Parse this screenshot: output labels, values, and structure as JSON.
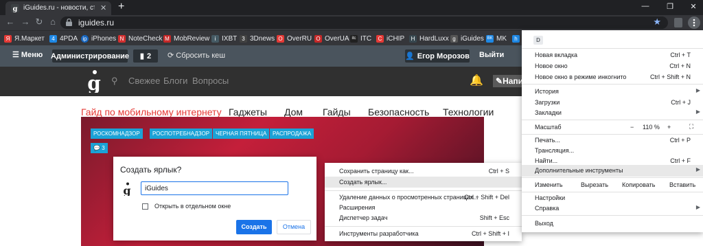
{
  "tab": {
    "title": "iGuides.ru - новости, статьи, видео",
    "close": "✕",
    "new": "+"
  },
  "window": {
    "minimize": "—",
    "restore": "❐",
    "close": "✕"
  },
  "nav": {
    "back": "←",
    "forward": "→",
    "reload": "↻",
    "home": "⌂"
  },
  "omnibox": {
    "url": "iguides.ru",
    "star": "★"
  },
  "bookmarks": [
    {
      "label": "Я.Маркет",
      "icon": "yamarket-icon",
      "color": "#e53935",
      "glyph": "Я"
    },
    {
      "label": "4PDA",
      "icon": "4pda-icon",
      "color": "#1e88e5",
      "glyph": "4"
    },
    {
      "label": "iPhones",
      "icon": "iphones-icon",
      "color": "#1565c0",
      "glyph": "ip"
    },
    {
      "label": "NoteCheck",
      "icon": "notecheck-icon",
      "color": "#d32f2f",
      "glyph": "N"
    },
    {
      "label": "MobReview",
      "icon": "mobreview-icon",
      "color": "#c62828",
      "glyph": "M"
    },
    {
      "label": "IXBT",
      "icon": "ixbt-icon",
      "color": "#455a64",
      "glyph": "i"
    },
    {
      "label": "3Dnews",
      "icon": "3dnews-icon",
      "color": "#424242",
      "glyph": "3"
    },
    {
      "label": "OverRU",
      "icon": "overru-icon",
      "color": "#e53935",
      "glyph": "O"
    },
    {
      "label": "OverUA",
      "icon": "overua-icon",
      "color": "#c62828",
      "glyph": "O"
    },
    {
      "label": "ITC",
      "icon": "itc-icon",
      "color": "#212121",
      "glyph": "itc"
    },
    {
      "label": "iCHIP",
      "icon": "ichip-icon",
      "color": "#e53935",
      "glyph": "C"
    },
    {
      "label": "HardLuxx",
      "icon": "hardluxx-icon",
      "color": "#37474f",
      "glyph": "H"
    },
    {
      "label": "iGuides",
      "icon": "iguides-icon",
      "color": "#555555",
      "glyph": "g"
    },
    {
      "label": "MK",
      "icon": "mk-icon",
      "color": "#1e88e5",
      "glyph": "ВК"
    },
    {
      "label": "",
      "icon": "h-icon",
      "color": "#1e88e5",
      "glyph": "h"
    }
  ],
  "admin": {
    "menu": "Меню",
    "admin": "Администрирование",
    "count": "2",
    "cache": "Сбросить кеш",
    "user": "Егор Морозов",
    "logout": "Выйти"
  },
  "site": {
    "nav": [
      "Свежее",
      "Блоги",
      "Вопросы"
    ],
    "write": "Напи"
  },
  "categories": [
    "Гайд по мобильному интернету",
    "Гаджеты",
    "Дом",
    "Гайды",
    "Безопасность",
    "Технологии"
  ],
  "tags": [
    "РОСКОМНАДЗОР",
    "РОСПОТРЕБНАДЗОР",
    "ЧЕРНАЯ ПЯТНИЦА",
    "РАСПРОДАЖА"
  ],
  "comments": "3",
  "dialog": {
    "title": "Создать ярлык?",
    "value": "iGuides",
    "checkbox": "Открыть в отдельном окне",
    "ok": "Создать",
    "cancel": "Отмена"
  },
  "submenu": [
    {
      "label": "Сохранить страницу как...",
      "shortcut": "Ctrl + S"
    },
    {
      "label": "Создать ярлык...",
      "shortcut": ""
    },
    {
      "label": "Удаление данных о просмотренных страницах...",
      "shortcut": "Ctrl + Shift + Del"
    },
    {
      "label": "Расширения",
      "shortcut": ""
    },
    {
      "label": "Диспетчер задач",
      "shortcut": "Shift + Esc"
    },
    {
      "label": "Инструменты разработчика",
      "shortcut": "Ctrl + Shift + I"
    }
  ],
  "menu": {
    "profile": "D",
    "new_tab": {
      "label": "Новая вкладка",
      "shortcut": "Ctrl + T"
    },
    "new_window": {
      "label": "Новое окно",
      "shortcut": "Ctrl + N"
    },
    "incognito": {
      "label": "Новое окно в режиме инкогнито",
      "shortcut": "Ctrl + Shift + N"
    },
    "history": "История",
    "downloads": {
      "label": "Загрузки",
      "shortcut": "Ctrl + J"
    },
    "bookmarks": "Закладки",
    "zoom": {
      "label": "Масштаб",
      "minus": "−",
      "value": "110 %",
      "plus": "+",
      "full": "⛶"
    },
    "print": {
      "label": "Печать...",
      "shortcut": "Ctrl + P"
    },
    "cast": "Трансляция...",
    "find": {
      "label": "Найти...",
      "shortcut": "Ctrl + F"
    },
    "more_tools": "Дополнительные инструменты",
    "edit": {
      "label": "Изменить",
      "cut": "Вырезать",
      "copy": "Копировать",
      "paste": "Вставить"
    },
    "settings": "Настройки",
    "help": "Справка",
    "exit": "Выход"
  },
  "colors": {
    "accent": "#1a73e8",
    "tag": "#1ba2d6",
    "category_highlight": "#e53935"
  }
}
